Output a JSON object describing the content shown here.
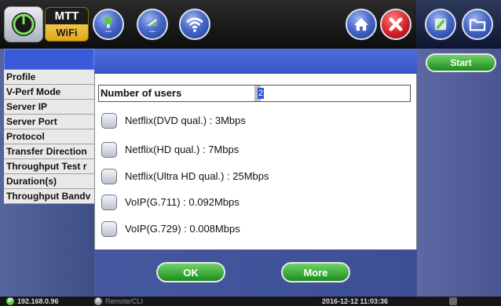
{
  "top_bar": {
    "app_badge": {
      "line1": "MTT",
      "line2": "WiFi"
    },
    "icons": [
      {
        "name": "network-icon",
        "badge": "---"
      },
      {
        "name": "signal-icon",
        "badge": "---"
      },
      {
        "name": "wifi-icon"
      },
      {
        "name": "home-icon"
      },
      {
        "name": "close-icon"
      },
      {
        "name": "tools-icon"
      },
      {
        "name": "folder-icon"
      }
    ],
    "accent_colors": {
      "close": "#d6202a",
      "top_icon": "#3e5dc4"
    }
  },
  "left_menu": {
    "items": [
      "Profile",
      "V-Perf Mode",
      "Server IP",
      "Server Port",
      "Protocol",
      "Transfer Direction",
      "Throughput Test r",
      "Duration(s)",
      "Throughput Bandv"
    ]
  },
  "dialog": {
    "users_label": "Number of users",
    "users_value": "2",
    "options": [
      {
        "label": "Netflix(DVD qual.) : 3Mbps",
        "checked": false
      },
      {
        "label": "Netflix(HD qual.) : 7Mbps",
        "checked": false
      },
      {
        "label": "Netflix(Ultra HD qual.) : 25Mbps",
        "checked": false
      },
      {
        "label": "VoIP(G.711) : 0.092Mbps",
        "checked": false
      },
      {
        "label": "VoIP(G.729) : 0.008Mbps",
        "checked": false
      }
    ],
    "ok_label": "OK",
    "more_label": "More"
  },
  "right_panel": {
    "start_label": "Start"
  },
  "status_bar": {
    "ip_badge": "IP",
    "ip": "192.168.0.96",
    "remote_badge": "R",
    "remote": "Remote/CLI",
    "datetime": "2016-12-12 11:03:36"
  }
}
